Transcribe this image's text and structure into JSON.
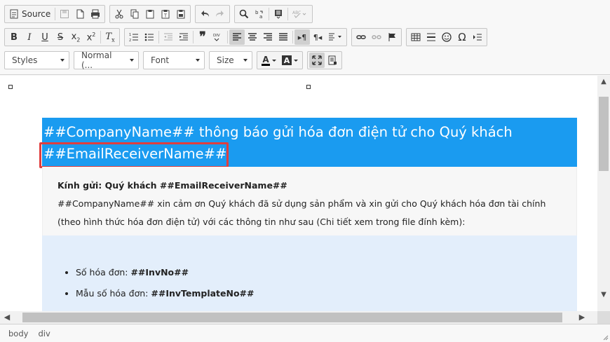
{
  "toolbar": {
    "source_label": "Source",
    "styles_combo": "Styles",
    "format_combo": "Normal (...",
    "font_combo": "Font",
    "size_combo": "Size",
    "text_color_letter": "A",
    "bg_color_letter": "A"
  },
  "document": {
    "header_line1": "##CompanyName## thông báo gửi hóa đơn điện tử cho Quý khách",
    "header_line2": "##EmailReceiverName##",
    "greeting_bold": "Kính gửi: Quý khách ##EmailReceiverName##",
    "greeting_line2": "##CompanyName## xin cảm ơn Quý khách đã sử dụng sản phẩm và xin gửi cho Quý khách hóa đơn tài chính",
    "greeting_line3": "(theo hình thức hóa đơn điện tử) với các thông tin như sau (Chi tiết xem trong file đính kèm):",
    "items": [
      {
        "label": "Số hóa đơn: ",
        "value": "##InvNo##"
      },
      {
        "label": "Mẫu số hóa đơn: ",
        "value": "##InvTemplateNo##"
      }
    ]
  },
  "statusbar": {
    "path": [
      "body",
      "div"
    ]
  },
  "colors": {
    "header_bg": "#1a9bf0",
    "highlight_border": "#e03e3e",
    "details_bg": "#e3eefb"
  }
}
